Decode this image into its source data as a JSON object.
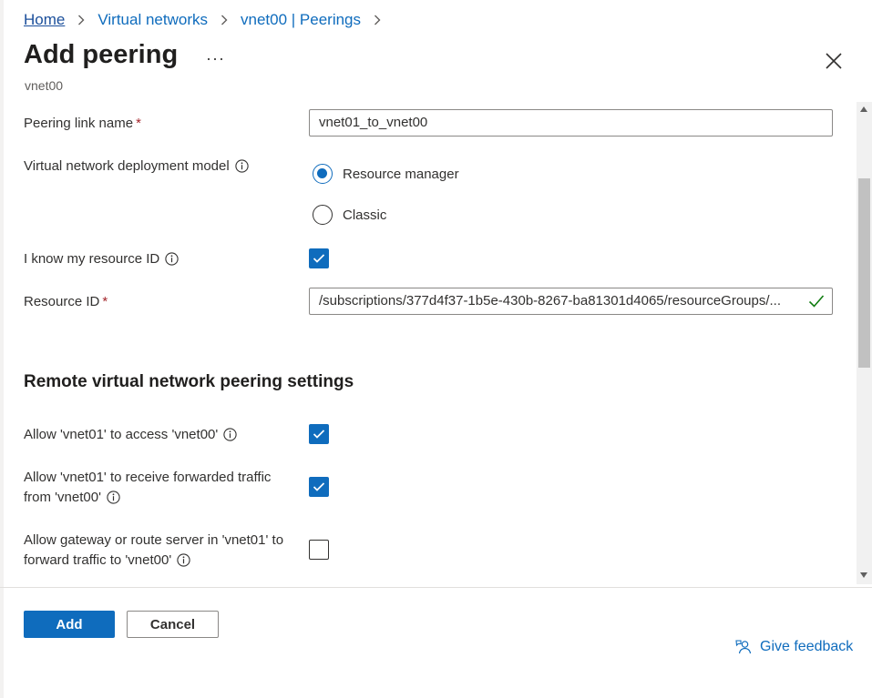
{
  "breadcrumb": [
    {
      "label": "Home"
    },
    {
      "label": "Virtual networks"
    },
    {
      "label": "vnet00 | Peerings"
    }
  ],
  "header": {
    "title": "Add peering",
    "more_label": "···",
    "subtitle": "vnet00"
  },
  "form": {
    "peering_link_name": {
      "label": "Peering link name",
      "required_mark": "*",
      "value": "vnet01_to_vnet00"
    },
    "deployment_model": {
      "label": "Virtual network deployment model",
      "options": [
        {
          "label": "Resource manager",
          "selected": true
        },
        {
          "label": "Classic",
          "selected": false
        }
      ]
    },
    "know_resource_id": {
      "label": "I know my resource ID",
      "checked": true
    },
    "resource_id": {
      "label": "Resource ID",
      "required_mark": "*",
      "value": "/subscriptions/377d4f37-1b5e-430b-8267-ba81301d4065/resourceGroups/...",
      "valid": true
    }
  },
  "remote_settings": {
    "heading": "Remote virtual network peering settings",
    "allow_access": {
      "label": "Allow 'vnet01' to access 'vnet00'",
      "checked": true
    },
    "allow_forwarded": {
      "line1": "Allow 'vnet01' to receive forwarded traffic",
      "line2": "from 'vnet00'",
      "checked": true
    },
    "allow_gateway": {
      "line1": "Allow gateway or route server in 'vnet01' to",
      "line2": "forward traffic to 'vnet00'",
      "checked": false
    }
  },
  "footer": {
    "add_label": "Add",
    "cancel_label": "Cancel",
    "feedback_label": "Give feedback"
  },
  "colors": {
    "accent": "#0f6cbd",
    "required": "#a4262c",
    "valid": "#107c10"
  }
}
